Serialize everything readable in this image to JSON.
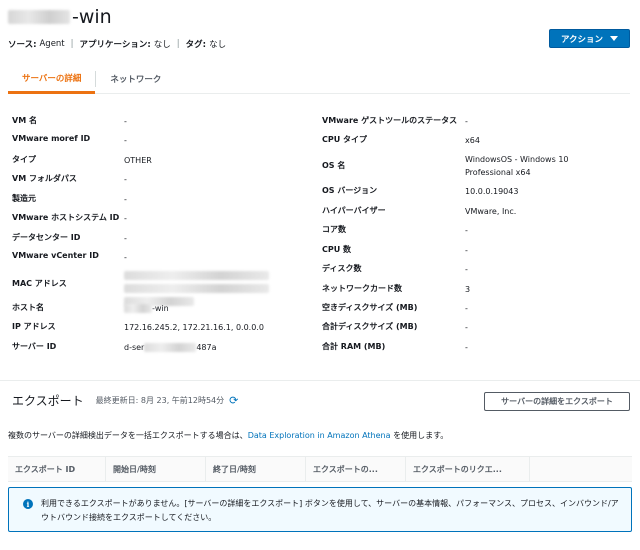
{
  "header": {
    "title_suffix": "-win",
    "action_label": "アクション"
  },
  "meta": {
    "source_label": "ソース:",
    "source_value": "Agent",
    "app_label": "アプリケーション:",
    "app_value": "なし",
    "tag_label": "タグ:",
    "tag_value": "なし",
    "separator": "|"
  },
  "tabs": [
    {
      "label": "サーバーの詳細",
      "active": true
    },
    {
      "label": "ネットワーク",
      "active": false
    }
  ],
  "details_left": [
    {
      "label": "VM 名",
      "value": "-"
    },
    {
      "label": "VMware moref ID",
      "value": "-"
    },
    {
      "label": "タイプ",
      "value": "OTHER"
    },
    {
      "label": "VM フォルダパス",
      "value": "-"
    },
    {
      "label": "製造元",
      "value": "-"
    },
    {
      "label": "VMware ホストシステム ID",
      "value": "-"
    },
    {
      "label": "データセンター ID",
      "value": "-"
    },
    {
      "label": "VMware vCenter ID",
      "value": "-"
    },
    {
      "label": "MAC アドレス",
      "value": ""
    },
    {
      "label": "ホスト名",
      "value": "-win"
    },
    {
      "label": "IP アドレス",
      "value": "172.16.245.2, 172.21.16.1, 0.0.0.0"
    },
    {
      "label": "サーバー ID",
      "value_prefix": "d-ser",
      "value_suffix": "487a"
    }
  ],
  "details_right": [
    {
      "label": "VMware ゲストツールのステータス",
      "value": "-"
    },
    {
      "label": "CPU タイプ",
      "value": "x64"
    },
    {
      "label": "OS 名",
      "value": "WindowsOS - Windows 10 Professional x64"
    },
    {
      "label": "OS バージョン",
      "value": "10.0.0.19043"
    },
    {
      "label": "ハイパーバイザー",
      "value": "VMware, Inc."
    },
    {
      "label": "コア数",
      "value": "-"
    },
    {
      "label": "CPU 数",
      "value": "-"
    },
    {
      "label": "ディスク数",
      "value": "-"
    },
    {
      "label": "ネットワークカード数",
      "value": "3"
    },
    {
      "label": "空きディスクサイズ (MB)",
      "value": "-"
    },
    {
      "label": "合計ディスクサイズ (MB)",
      "value": "-"
    },
    {
      "label": "合計 RAM (MB)",
      "value": "-"
    }
  ],
  "export": {
    "title": "エクスポート",
    "updated": "最終更新日: 8月 23, 午前12時54分",
    "button_label": "サーバーの詳細をエクスポート",
    "desc_before": "複数のサーバーの詳細検出データを一括エクスポートする場合は、",
    "desc_link": "Data Exploration in Amazon Athena",
    "desc_after": " を使用します。",
    "columns": [
      "エクスポート ID",
      "開始日/時刻",
      "終了日/時刻",
      "エクスポートの...",
      "エクスポートのリクエ..."
    ],
    "empty_message": "利用できるエクスポートがありません。[サーバーの詳細をエクスポート] ボタンを使用して、サーバーの基本情報、パフォーマンス、プロセス、インバウンド/アウトバウンド接続をエクスポートしてください。"
  },
  "icons": {
    "refresh": "refresh-icon",
    "info": "info-icon",
    "caret": "caret-down-icon"
  },
  "colors": {
    "primary": "#0073bb",
    "accent_tab": "#ec7211",
    "info_bg": "#f1faff"
  }
}
